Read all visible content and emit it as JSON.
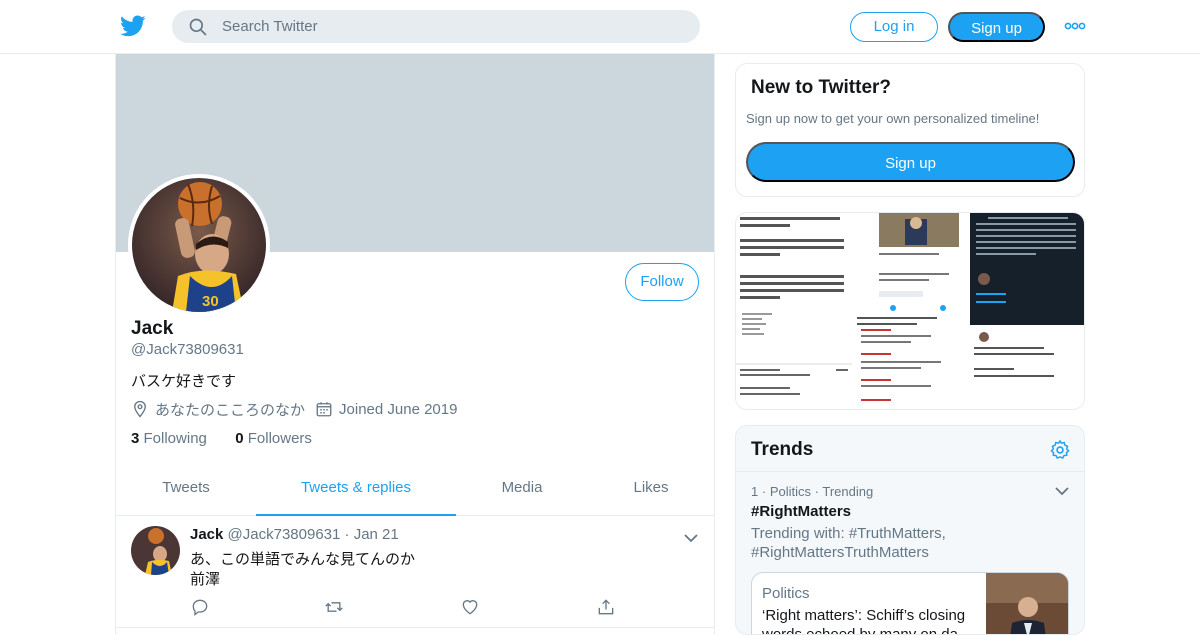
{
  "topbar": {
    "logo_icon": "twitter-bird-icon",
    "search_placeholder": "Search Twitter",
    "login_label": "Log in",
    "signup_label": "Sign up",
    "more_icon": "more-dots-icon",
    "brand_color": "#1da1f2"
  },
  "profile": {
    "name": "Jack",
    "handle": "@Jack73809631",
    "bio": "バスケ好きです",
    "location": "あなたのこころのなか",
    "joined": "Joined June 2019",
    "following_count": "3",
    "following_label": "Following",
    "followers_count": "0",
    "followers_label": "Followers",
    "follow_label": "Follow"
  },
  "tabs": [
    {
      "label": "Tweets",
      "active": false
    },
    {
      "label": "Tweets & replies",
      "active": true
    },
    {
      "label": "Media",
      "active": false
    },
    {
      "label": "Likes",
      "active": false
    }
  ],
  "tweet": {
    "name": "Jack",
    "handle": "@Jack73809631",
    "sep": "·",
    "date": "Jan 21",
    "line1": "あ、この単語でみんな見てんのか",
    "line2": "前澤"
  },
  "signup_card": {
    "title": "New to Twitter?",
    "subtitle": "Sign up now to get your own personalized timeline!",
    "button": "Sign up"
  },
  "media": {
    "cells": [
      {
        "icon": "screenshot-thumbnail"
      },
      {
        "icon": "screenshot-thumbnail"
      },
      {
        "icon": "screenshot-thumbnail"
      },
      {
        "icon": "screenshot-thumbnail"
      },
      {
        "icon": "screenshot-thumbnail"
      },
      {
        "icon": "screenshot-thumbnail"
      }
    ]
  },
  "trends": {
    "title": "Trends",
    "item": {
      "rank": "1",
      "dot": "·",
      "category": "Politics",
      "status": "Trending",
      "tag": "#RightMatters",
      "with": "Trending with: #TruthMatters, #RightMattersTruthMatters"
    },
    "news": {
      "category": "Politics",
      "title": "‘Right matters’: Schiff’s closing words echoed by many on da"
    }
  }
}
